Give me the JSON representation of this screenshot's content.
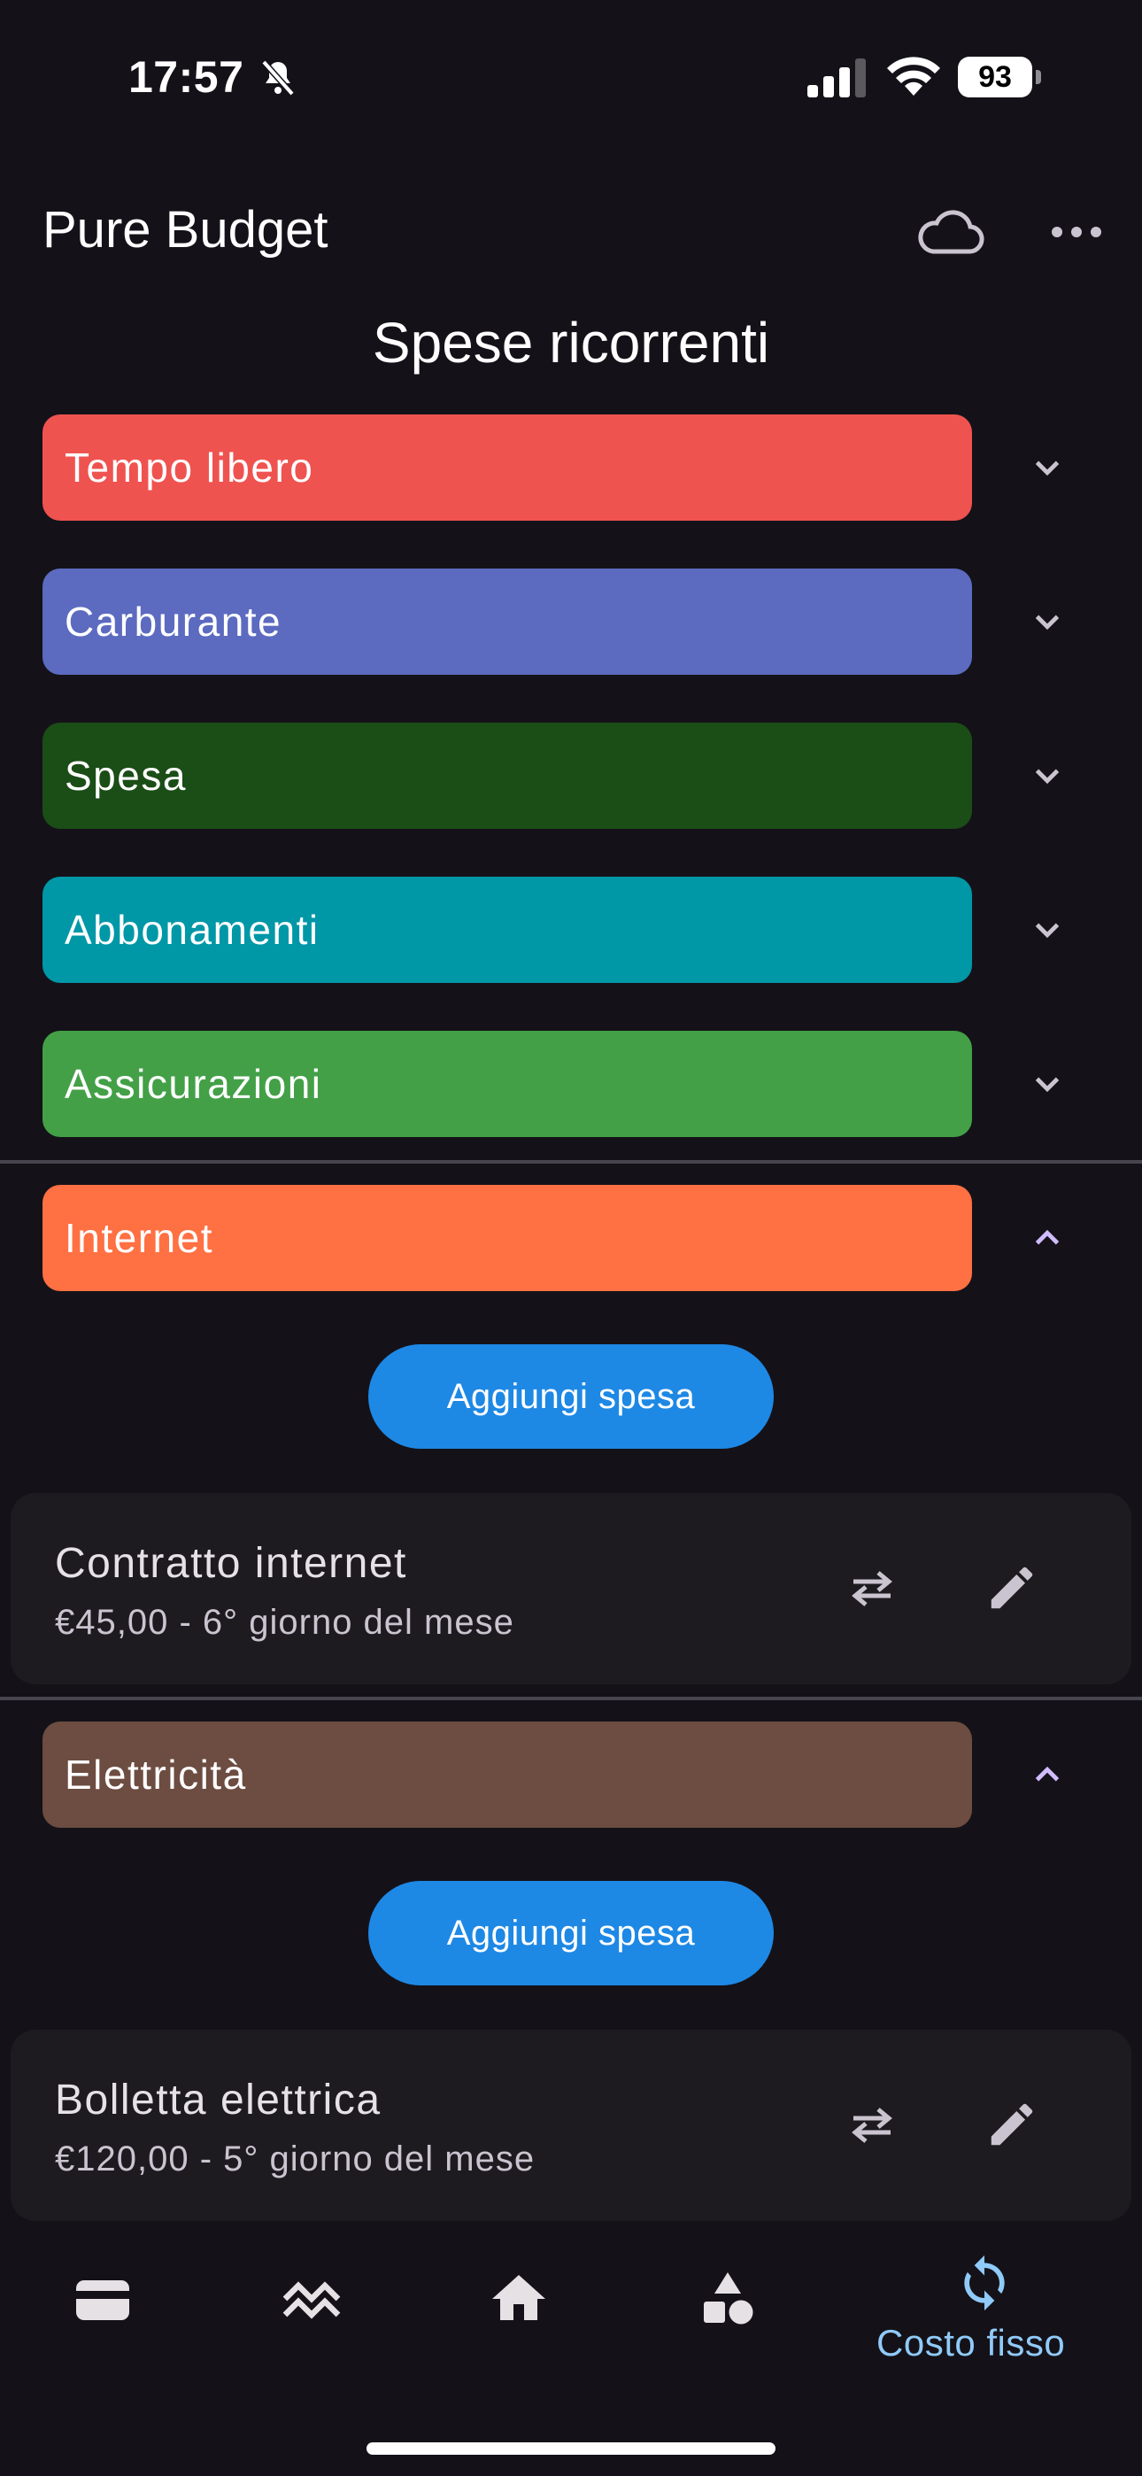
{
  "status_bar": {
    "time": "17:57",
    "battery": "93"
  },
  "app_bar": {
    "title": "Pure Budget",
    "icons": [
      "cloud-icon",
      "more-horizontal-icon"
    ]
  },
  "page_title": "Spese ricorrenti",
  "categories": [
    {
      "label": "Tempo libero",
      "color": "#ef5350",
      "expanded": false
    },
    {
      "label": "Carburante",
      "color": "#5c6bc0",
      "expanded": false
    },
    {
      "label": "Spesa",
      "color": "#1b4d17",
      "expanded": false
    },
    {
      "label": "Abbonamenti",
      "color": "#0097a7",
      "expanded": false
    },
    {
      "label": "Assicurazioni",
      "color": "#43a047",
      "expanded": false
    },
    {
      "label": "Internet",
      "color": "#ff7043",
      "expanded": true
    },
    {
      "label": "Elettricità",
      "color": "#6d4c41",
      "expanded": true
    }
  ],
  "add_button_label": "Aggiungi spesa",
  "expenses": {
    "internet": {
      "title": "Contratto internet",
      "subtitle": "€45,00 - 6° giorno del mese"
    },
    "electricity": {
      "title": "Bolletta elettrica",
      "subtitle": "€120,00 - 5° giorno del mese"
    }
  },
  "bottom_nav": {
    "items": [
      "wallet-icon",
      "trend-icon",
      "home-icon",
      "categories-icon",
      "recurring-icon"
    ],
    "active_label": "Costo fisso",
    "accent": "#90caf9"
  }
}
